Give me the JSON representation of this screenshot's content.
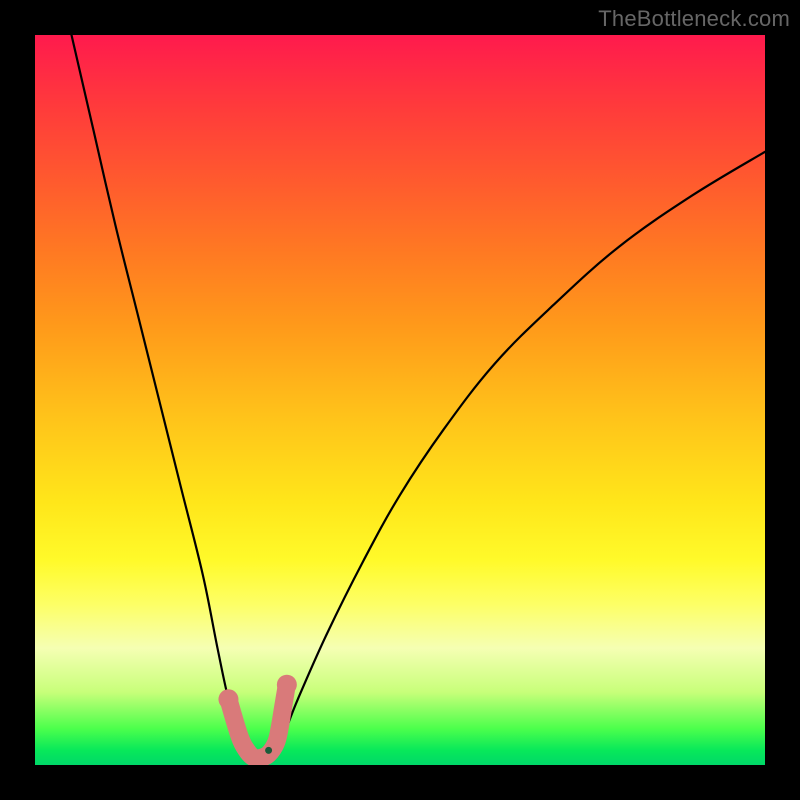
{
  "watermark": "TheBottleneck.com",
  "chart_data": {
    "type": "line",
    "title": "",
    "xlabel": "",
    "ylabel": "",
    "xlim": [
      0,
      100
    ],
    "ylim": [
      0,
      100
    ],
    "series": [
      {
        "name": "bottleneck-curve",
        "x": [
          5,
          8,
          11,
          14,
          17,
          20,
          23,
          25,
          26.5,
          28,
          29.5,
          31,
          32.5,
          34,
          36,
          40,
          45,
          50,
          56,
          63,
          71,
          80,
          90,
          100
        ],
        "values": [
          100,
          87,
          74,
          62,
          50,
          38,
          26,
          16,
          9,
          4,
          1.5,
          1,
          1.5,
          4,
          9,
          18,
          28,
          37,
          46,
          55,
          63,
          71,
          78,
          84
        ]
      }
    ],
    "markers": {
      "name": "u-shape-markers",
      "color": "#d97a7a",
      "points": [
        {
          "x": 26.5,
          "y": 9
        },
        {
          "x": 28,
          "y": 4
        },
        {
          "x": 29,
          "y": 2
        },
        {
          "x": 30,
          "y": 1
        },
        {
          "x": 31,
          "y": 1
        },
        {
          "x": 32,
          "y": 1.5
        },
        {
          "x": 33,
          "y": 3
        },
        {
          "x": 33.5,
          "y": 5
        },
        {
          "x": 34,
          "y": 8
        },
        {
          "x": 34.5,
          "y": 11
        }
      ]
    },
    "dot": {
      "x": 32,
      "y": 2,
      "color": "#1a5c3a"
    }
  }
}
